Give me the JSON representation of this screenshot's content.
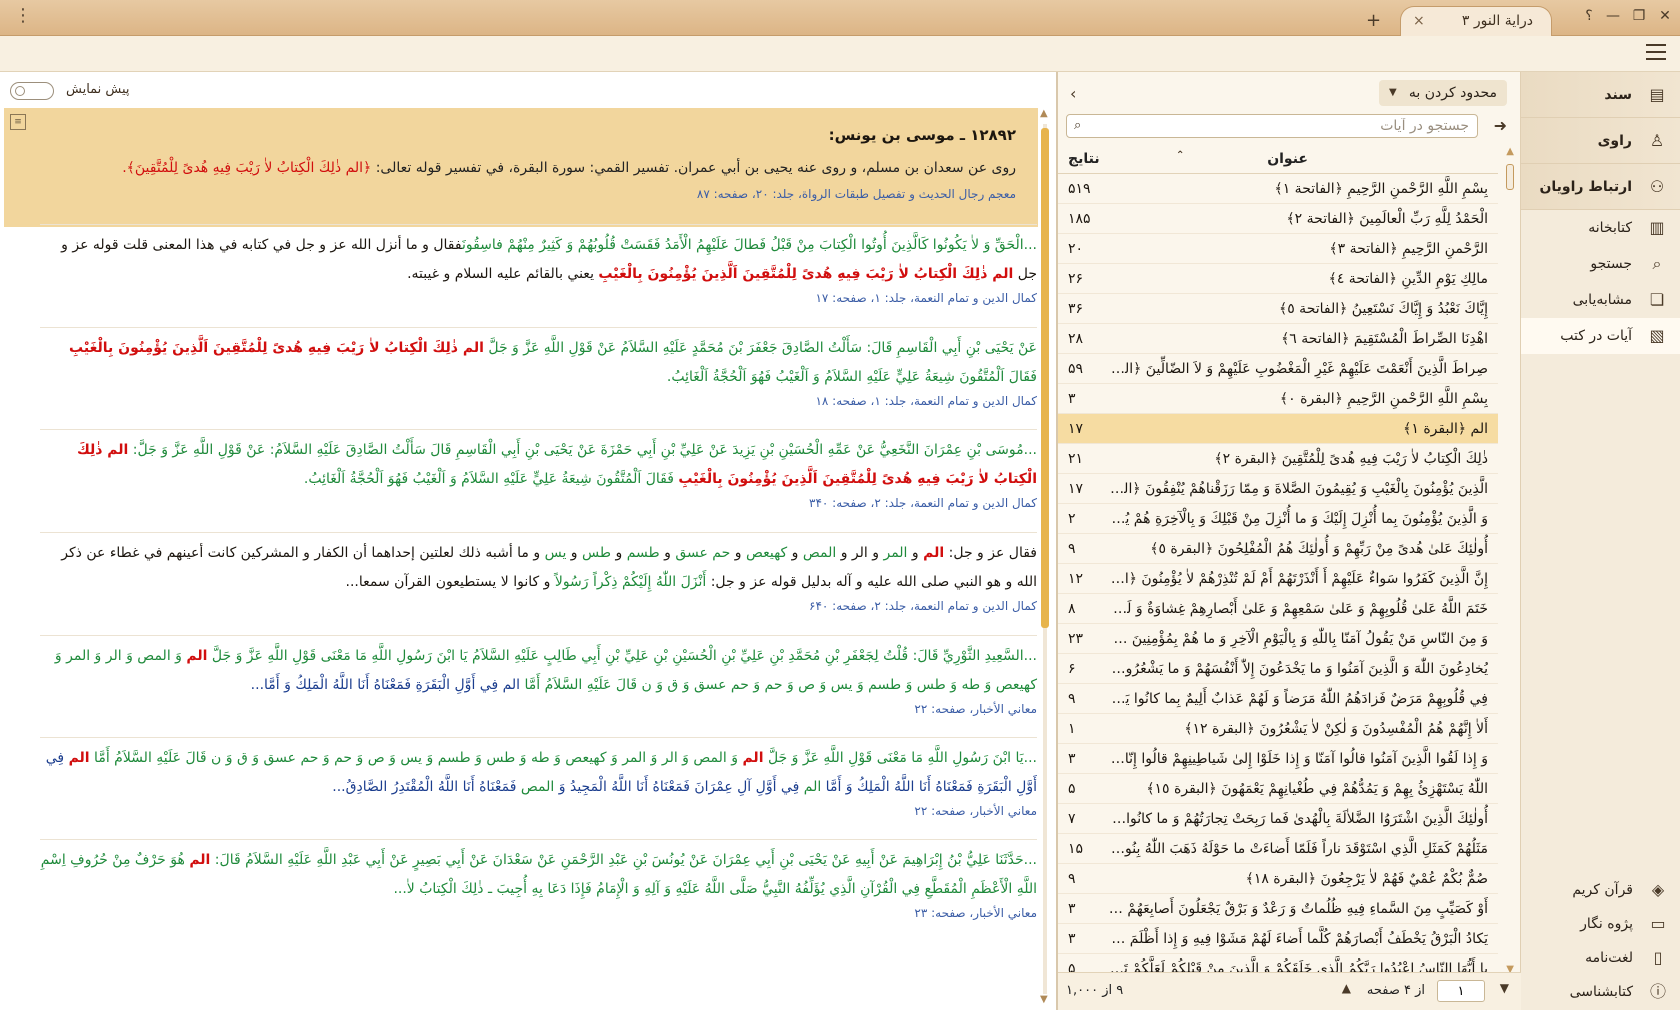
{
  "titlebar": {
    "tab_title": "درایة النور ۳",
    "new_tab_symbol": "+",
    "help_symbol": "؟",
    "minimize_symbol": "—",
    "maximize_symbol": "❐",
    "close_symbol": "✕",
    "tab_close_symbol": "×"
  },
  "nav": {
    "items": [
      {
        "label": "سند",
        "icon": "document-icon"
      },
      {
        "label": "راوی",
        "icon": "person-icon"
      },
      {
        "label": "ارتباط راویان",
        "icon": "network-icon"
      },
      {
        "label": "کتابخانه",
        "icon": "books-icon"
      },
      {
        "label": "جستجو",
        "icon": "search-icon"
      },
      {
        "label": "مشابه‌یابی",
        "icon": "compare-icon"
      },
      {
        "label": "آیات در کتب",
        "icon": "verses-book-icon"
      }
    ],
    "bottom": [
      {
        "label": "قرآن کریم",
        "icon": "quran-icon"
      },
      {
        "label": "پژوه نگار",
        "icon": "note-icon"
      },
      {
        "label": "لغت‌نامه",
        "icon": "dictionary-icon"
      },
      {
        "label": "کتابشناسی",
        "icon": "info-icon"
      }
    ]
  },
  "verses_panel": {
    "limit_label": "محدود کردن به",
    "search_placeholder": "جستجو در آیات",
    "col_title": "عنوان",
    "col_count": "نتایج",
    "rows": [
      {
        "t": "بِسْمِ اللَّهِ الرَّحْمنِ الرَّحِيمِ ﴿الفاتحة ١﴾",
        "c": "۵۱۹"
      },
      {
        "t": "الْحَمْدُ لِلَّهِ رَبِّ الْعالَمِينَ ﴿الفاتحة ٢﴾",
        "c": "۱۸۵"
      },
      {
        "t": "الرَّحْمنِ الرَّحِيمِ ﴿الفاتحة ٣﴾",
        "c": "۲۰"
      },
      {
        "t": "مالِكِ يَوْمِ الدِّينِ ﴿الفاتحة ٤﴾",
        "c": "۲۶"
      },
      {
        "t": "إِيَّاكَ نَعْبُدُ وَ إِيَّاكَ نَسْتَعِينُ ﴿الفاتحة ٥﴾",
        "c": "۳۶"
      },
      {
        "t": "اهْدِنَا الصِّراطَ الْمُسْتَقِيمَ ﴿الفاتحة ٦﴾",
        "c": "۲۸"
      },
      {
        "t": "صِراطَ الَّذِينَ أَنْعَمْتَ عَلَيْهِمْ غَيْرِ الْمَغْضُوبِ عَلَيْهِمْ وَ لاَ الضّالِّينَ ﴿الفاتح...",
        "c": "۵۹"
      },
      {
        "t": "بِسْمِ اللَّهِ الرَّحْمنِ الرَّحِيمِ ﴿البقرة ٠﴾",
        "c": "۳"
      },
      {
        "t": "الم ﴿البقرة ١﴾",
        "c": "۱۷"
      },
      {
        "t": "ذٰلِكَ الْكِتابُ لاٰ رَيْبَ فِيهِ هُدىً لِلْمُتَّقِينَ ﴿البقرة ٢﴾",
        "c": "۲۱"
      },
      {
        "t": "الَّذِينَ يُؤْمِنُونَ بِالْغَيْبِ وَ يُقِيمُونَ الصَّلاةَ وَ مِمّا رَزَقْناهُمْ يُنْفِقُونَ ﴿البقرة...",
        "c": "۱۷"
      },
      {
        "t": "وَ الَّذِينَ يُؤْمِنُونَ بِما أُنْزِلَ إِلَيْكَ وَ ما أُنْزِلَ مِنْ قَبْلِكَ وَ بِالْآخِرَةِ هُمْ يُوقِ...",
        "c": "۲"
      },
      {
        "t": "أُولٰئِكَ عَلىٰ هُدىً مِنْ رَبِّهِمْ وَ أُولٰئِكَ هُمُ الْمُفْلِحُونَ ﴿البقرة ٥﴾",
        "c": "۹"
      },
      {
        "t": "إِنَّ الَّذِينَ كَفَرُوا سَواءٌ عَلَيْهِمْ أَ أَنْذَرْتَهُمْ أَمْ لَمْ تُنْذِرْهُمْ لاٰ يُؤْمِنُونَ ﴿البقرة...",
        "c": "۱۲"
      },
      {
        "t": "خَتَمَ اللَّهُ عَلىٰ قُلُوبِهِمْ وَ عَلىٰ سَمْعِهِمْ وَ عَلىٰ أَبْصارِهِمْ غِشاوَةٌ وَ لَهُمْ عَ...",
        "c": "۸"
      },
      {
        "t": "وَ مِنَ النّاسِ مَنْ يَقُولُ آمَنّا بِاللّٰهِ وَ بِالْيَوْمِ الْآخِرِ وَ ما هُمْ بِمُؤْمِنِينَ ﴿البق...",
        "c": "۲۳"
      },
      {
        "t": "يُخادِعُونَ اللّٰهَ وَ الَّذِينَ آمَنُوا وَ ما يَخْدَعُونَ إِلاّٰ أَنْفُسَهُمْ وَ ما يَشْعُرُونَ ﴿ا...",
        "c": "۶"
      },
      {
        "t": "فِي قُلُوبِهِمْ مَرَضٌ فَزادَهُمُ اللّٰهُ مَرَضاً وَ لَهُمْ عَذابٌ أَلِيمٌ بِما كانُوا يَكْذِبُو...",
        "c": "۹"
      },
      {
        "t": "أَلاٰ إِنَّهُمْ هُمُ الْمُفْسِدُونَ وَ لٰكِنْ لاٰ يَشْعُرُونَ ﴿البقرة ١٢﴾",
        "c": "۱"
      },
      {
        "t": "وَ إِذا لَقُوا الَّذِينَ آمَنُوا قالُوا آمَنّا وَ إِذا خَلَوْا إِلىٰ شَياطِينِهِمْ قالُوا إِنّا مَعَكُمْ...",
        "c": "۳"
      },
      {
        "t": "اللّٰهُ يَسْتَهْزِئُ بِهِمْ وَ يَمُدُّهُمْ فِي طُغْيانِهِمْ يَعْمَهُونَ ﴿البقرة ١٥﴾",
        "c": "۵"
      },
      {
        "t": "أُولٰئِكَ الَّذِينَ اشْتَرَوُا الضَّلاٰلَةَ بِالْهُدىٰ فَما رَبِحَتْ تِجارَتُهُمْ وَ ما كانُوا مُهْ...",
        "c": "۷"
      },
      {
        "t": "مَثَلُهُمْ كَمَثَلِ الَّذِي اسْتَوْقَدَ ناراً فَلَمّا أَضاءَتْ ما حَوْلَهُ ذَهَبَ اللّٰهُ بِنُورِهِم...",
        "c": "۱۵"
      },
      {
        "t": "صُمٌّ بُكْمٌ عُمْيٌ فَهُمْ لاٰ يَرْجِعُونَ ﴿البقرة ١٨﴾",
        "c": "۹"
      },
      {
        "t": "أَوْ كَصَيِّبٍ مِنَ السَّماءِ فِيهِ ظُلُماتٌ وَ رَعْدٌ وَ بَرْقٌ يَجْعَلُونَ أَصابِعَهُمْ فِي آ...",
        "c": "۳"
      },
      {
        "t": "يَكادُ الْبَرْقُ يَخْطَفُ أَبْصارَهُمْ كُلَّما أَضاءَ لَهُمْ مَشَوْا فِيهِ وَ إِذا أَظْلَمَ عَلَيْه...",
        "c": "۳"
      },
      {
        "t": "يا أَيُّهَا النّاسُ اعْبُدُوا رَبَّكُمُ الَّذِي خَلَقَكُمْ وَ الَّذِينَ مِنْ قَبْلِكُمْ لَعَلَّكُمْ تَتَّقُو...",
        "c": "۵"
      }
    ],
    "selected_index": 8,
    "pager": {
      "count": "۹ از ۱,۰۰۰",
      "page_value": "۱",
      "of_pages": "از ۴ صفحه"
    }
  },
  "content": {
    "preview_label": "پیش نمایش",
    "hit": {
      "title": "۱۲۸۹۲ ـ موسى بن يونس:",
      "body_plain": "روى عن سعدان بن مسلم، و روى عنه يحيى بن أبي عمران. تفسير القمي: سورة البقرة، في تفسير قوله تعالى: ",
      "body_red": "﴿الم ذٰلِكَ الْكِتابُ لاٰ رَيْبَ فِيهِ هُدىً لِلْمُتَّقِينَ﴾.",
      "source": "معجم رجال الحديث و تفصيل طبقات الرواة، جلد: ۲۰، صفحه: ۸۷"
    },
    "entries": [
      {
        "parts": [
          [
            "grn",
            "...الْحَقِّ وَ لاٰ يَكُونُوا كَالَّذِينَ أُوتُوا الْكِتابَ مِنْ قَبْلُ فَطالَ عَلَيْهِمُ الْأَمَدُ فَقَسَتْ قُلُوبُهُمْ وَ كَثِيرٌ مِنْهُمْ فاسِقُونَ"
          ],
          [
            "",
            "فقال و ما أنزل الله عز و جل في كتابه في هذا المعنى قلت قوله عز و جل "
          ],
          [
            "red",
            "الم ذٰلِكَ الْكِتابُ لاٰ رَيْبَ فِيهِ هُدىً لِلْمُتَّقِينَ اَلَّذِينَ يُؤْمِنُونَ بِالْغَيْبِ"
          ],
          [
            "",
            " يعني بالقائم عليه السلام و غيبته."
          ]
        ],
        "source": "كمال الدين و تمام النعمة، جلد: ۱، صفحه: ۱۷"
      },
      {
        "parts": [
          [
            "grn",
            "عَنْ يَحْيَى بْنِ أَبِي الْقَاسِمِ قَالَ: سَأَلْتُ الصَّادِقَ جَعْفَرَ بْنَ مُحَمَّدٍ عَلَيْهِ السَّلاَمُ عَنْ قَوْلِ اللَّهِ عَزَّ وَ جَلَّ "
          ],
          [
            "red",
            "الم ذٰلِكَ الْكِتابُ لاٰ رَيْبَ فِيهِ هُدىً لِلْمُتَّقِينَ اَلَّذِينَ يُؤْمِنُونَ بِالْغَيْبِ"
          ],
          [
            "grn",
            " فَقَالَ اَلْمُتَّقُونَ شِيعَةُ عَلِيٍّ عَلَيْهِ السَّلاَمُ وَ اَلْغَيْبُ فَهُوَ اَلْحُجَّةُ اَلْغَائِبُ."
          ]
        ],
        "source": "كمال الدين و تمام النعمة، جلد: ۱، صفحه: ۱۸"
      },
      {
        "parts": [
          [
            "grn",
            "...مُوسَى بْنِ عِمْرَانَ النَّخَعِيُّ عَنْ عَمِّهِ الْحُسَيْنِ بْنِ يَزِيدَ عَنْ عَلِيِّ بْنِ أَبِي حَمْزَةَ عَنْ يَحْيَى بْنِ أَبِي الْقَاسِمِ قَالَ سَأَلْتُ الصَّادِقَ عَلَيْهِ السَّلاَمُ: عَنْ قَوْلِ اللَّهِ عَزَّ وَ جَلَّ: "
          ],
          [
            "red",
            "الم ذٰلِكَ الْكِتابُ لاٰ رَيْبَ فِيهِ هُدىً لِلْمُتَّقِينَ اَلَّذِينَ يُؤْمِنُونَ بِالْغَيْبِ"
          ],
          [
            "grn",
            " فَقَالَ اَلْمُتَّقُونَ شِيعَةُ عَلِيٍّ عَلَيْهِ السَّلاَمُ وَ اَلْغَيْبُ فَهُوَ اَلْحُجَّةُ اَلْغَائِبُ."
          ]
        ],
        "source": "كمال الدين و تمام النعمة، جلد: ۲، صفحه: ۳۴۰"
      },
      {
        "parts": [
          [
            "",
            "فقال عز و جل: "
          ],
          [
            "red",
            "الم"
          ],
          [
            "",
            " و "
          ],
          [
            "grn",
            "المر"
          ],
          [
            "",
            " و الر و "
          ],
          [
            "grn",
            "المص"
          ],
          [
            "",
            " و "
          ],
          [
            "grn",
            "كهيعص"
          ],
          [
            "",
            " و "
          ],
          [
            "grn",
            "حم عسق"
          ],
          [
            "",
            " و "
          ],
          [
            "grn",
            "طسم"
          ],
          [
            "",
            " و "
          ],
          [
            "grn",
            "طس"
          ],
          [
            "",
            " و "
          ],
          [
            "grn",
            "يس"
          ],
          [
            "",
            " و ما أشبه ذلك لعلتين إحداهما أن الكفار و المشركين كانت أعينهم في غطاء عن ذكر الله و هو النبي صلى الله عليه و آله بدليل قوله عز و جل: "
          ],
          [
            "grn",
            "أَنْزَلَ اللّٰهُ إِلَيْكُمْ ذِكْراً رَسُولاً"
          ],
          [
            "",
            " و كانوا لا يستطيعون القرآن سمعا..."
          ]
        ],
        "source": "كمال الدين و تمام النعمة، جلد: ۲، صفحه: ۶۴۰"
      },
      {
        "parts": [
          [
            "grn",
            "...السَّعِيدِ الثَّوْرِيِّ قَالَ: قُلْتُ لِجَعْفَرِ بْنِ مُحَمَّدِ بْنِ عَلِيِّ بْنِ الْحُسَيْنِ بْنِ عَلِيِّ بْنِ أَبِي طَالِبٍ عَلَيْهِ السَّلاَمُ يَا ابْنَ رَسُولِ اللَّهِ مَا مَعْنَى قَوْلِ اللَّهِ عَزَّ وَ جَلَّ "
          ],
          [
            "red",
            "الم"
          ],
          [
            "grn",
            " وَ المص وَ الر وَ المر وَ كهيعص وَ طه وَ طس وَ طسم وَ يس وَ ص وَ حم وَ حم عسق وَ ق وَ ن قَالَ عَلَيْهِ السَّلاَمُ أَمَّا "
          ],
          [
            "blu",
            "الم فِي أَوَّلِ الْبَقَرَةِ فَمَعْنَاهُ أَنَا اللَّهُ الْمَلِكُ وَ أَمَّا..."
          ]
        ],
        "source": "معاني الأخبار، صفحه: ۲۲"
      },
      {
        "parts": [
          [
            "grn",
            "...يَا ابْنَ رَسُولِ اللَّهِ مَا مَعْنَى قَوْلِ اللَّهِ عَزَّ وَ جَلَّ "
          ],
          [
            "red",
            "الم"
          ],
          [
            "grn",
            " وَ المص وَ الر وَ المر وَ كهيعص وَ طه وَ طس وَ طسم وَ يس وَ ص وَ حم وَ حم عسق وَ ق وَ ن قَالَ عَلَيْهِ السَّلاَمُ أَمَّا "
          ],
          [
            "red",
            "الم"
          ],
          [
            "blu",
            " فِي أَوَّلِ الْبَقَرَةِ فَمَعْنَاهُ أَنَا اللَّهُ الْمَلِكُ وَ أَمَّا "
          ],
          [
            "grn",
            "الم"
          ],
          [
            "blu",
            " فِي أَوَّلِ آلِ عِمْرَانَ فَمَعْنَاهُ أَنَا اللَّهُ الْمَجِيدُ وَ "
          ],
          [
            "grn",
            "المص"
          ],
          [
            "blu",
            " فَمَعْنَاهُ أَنَا اللَّهُ الْمُقْتَدِرُ الصَّادِقُ..."
          ]
        ],
        "source": "معاني الأخبار، صفحه: ۲۲"
      },
      {
        "parts": [
          [
            "grn",
            "...حَدَّثَنَا عَلِيُّ بْنُ إِبْرَاهِيمَ عَنْ أَبِيهِ عَنْ يَحْيَى بْنِ أَبِي عِمْرَانَ عَنْ يُونُسَ بْنِ عَبْدِ الرَّحْمَنِ عَنْ سَعْدَانَ عَنْ أَبِي بَصِيرٍ عَنْ أَبِي عَبْدِ اللَّهِ عَلَيْهِ السَّلاَمُ قَالَ: "
          ],
          [
            "red",
            "الم"
          ],
          [
            "grn",
            " هُوَ حَرْفٌ مِنْ حُرُوفِ اِسْمِ اللَّهِ الْأَعْظَمِ الْمُقَطَّعِ فِي الْقُرْآنِ الَّذِي يُؤَلِّفُهُ النَّبِيُّ صَلَّى اللَّهُ عَلَيْهِ وَ آلِهِ وَ الْإِمَامُ فَإِذَا دَعَا بِهِ أُجِيبَ ـ ذٰلِكَ الْكِتابُ لاٰ..."
          ]
        ],
        "source": "معاني الأخبار، صفحه: ۲۳"
      }
    ]
  }
}
